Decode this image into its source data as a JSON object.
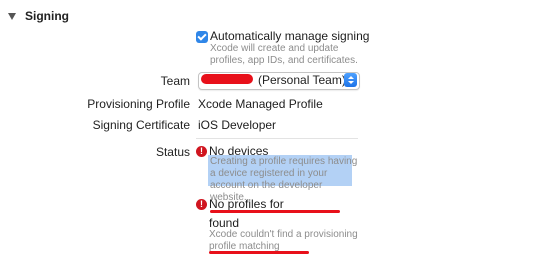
{
  "section": {
    "title": "Signing"
  },
  "auto_signing": {
    "checkbox_label": "Automatically manage signing",
    "help_text": "Xcode will create and update profiles, app IDs, and certificates.",
    "checked": true
  },
  "team": {
    "label": "Team",
    "value_suffix": "(Personal Team)"
  },
  "provisioning_profile": {
    "label": "Provisioning Profile",
    "value": "Xcode Managed Profile"
  },
  "signing_certificate": {
    "label": "Signing Certificate",
    "value": "iOS Developer"
  },
  "status": {
    "label": "Status",
    "errors": [
      {
        "title": "No devices",
        "help_text": "Creating a profile requires having a device registered in your account on the developer website."
      },
      {
        "title": "No profiles for",
        "title_continued": "found",
        "help_text": "Xcode couldn't find a provisioning profile matching"
      }
    ]
  },
  "colors": {
    "accent_blue": "#2f86e8",
    "error_red": "#d0151f",
    "redaction_red": "#e8101a",
    "selection_highlight": "#b3d1f5"
  },
  "icons": {
    "disclosure": "disclosure-triangle-down-icon",
    "checkbox": "checkmark-icon",
    "popup_stepper": "up-down-chevron-icon",
    "error": "exclamation-circle-icon"
  }
}
